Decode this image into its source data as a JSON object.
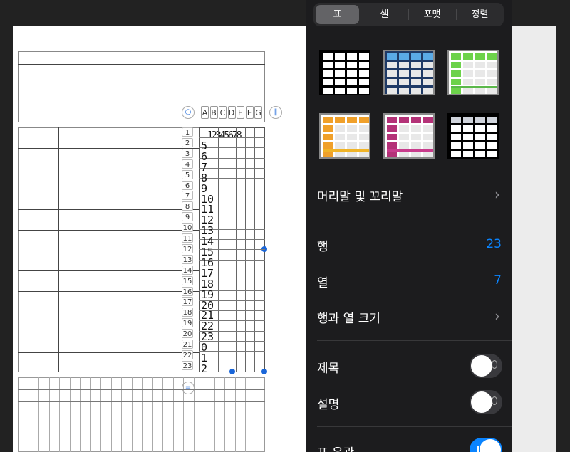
{
  "tabs": [
    {
      "label": "표",
      "active": true
    },
    {
      "label": "셀",
      "active": false
    },
    {
      "label": "포맷",
      "active": false
    },
    {
      "label": "정렬",
      "active": false
    }
  ],
  "table_styles": [
    {
      "name": "plain-black",
      "header": "#000000",
      "accent": "#000000"
    },
    {
      "name": "blue",
      "header": "#5aaae6",
      "accent": "#1f3a66"
    },
    {
      "name": "green",
      "header": "#6cd24a",
      "accent": "#5ab84a"
    },
    {
      "name": "orange",
      "header": "#f0a02a",
      "accent": "#f0b428"
    },
    {
      "name": "magenta",
      "header": "#b43278",
      "accent": "#c83c8c"
    },
    {
      "name": "gray",
      "header": "#d0d4dc",
      "accent": "#000000"
    }
  ],
  "settings": {
    "header_footer_label": "머리말 및 꼬리말",
    "rows_label": "행",
    "rows_value": "23",
    "columns_label": "열",
    "columns_value": "7",
    "row_col_size_label": "행과 열 크기",
    "title_label": "제목",
    "title_on": false,
    "caption_label": "설명",
    "caption_on": false,
    "table_outline_label": "표 윤곽",
    "table_outline_on": true
  },
  "sheet": {
    "column_headers": [
      "A",
      "B",
      "C",
      "D",
      "E",
      "F",
      "G"
    ],
    "row_numbers": [
      "1",
      "2",
      "3",
      "4",
      "5",
      "6",
      "7",
      "8",
      "9",
      "10",
      "11",
      "12",
      "13",
      "14",
      "15",
      "16",
      "17",
      "18",
      "19",
      "20",
      "21",
      "22",
      "23"
    ],
    "vertical_numbers": [
      "5",
      "6",
      "7",
      "8",
      "9",
      "10",
      "11",
      "12",
      "13",
      "14",
      "15",
      "16",
      "17",
      "18",
      "19",
      "20",
      "21",
      "22",
      "23",
      "0",
      "1",
      "2"
    ],
    "header_numbers": "12345678"
  },
  "colors": {
    "accent": "#0a84ff",
    "panel": "#1c1c1e"
  }
}
